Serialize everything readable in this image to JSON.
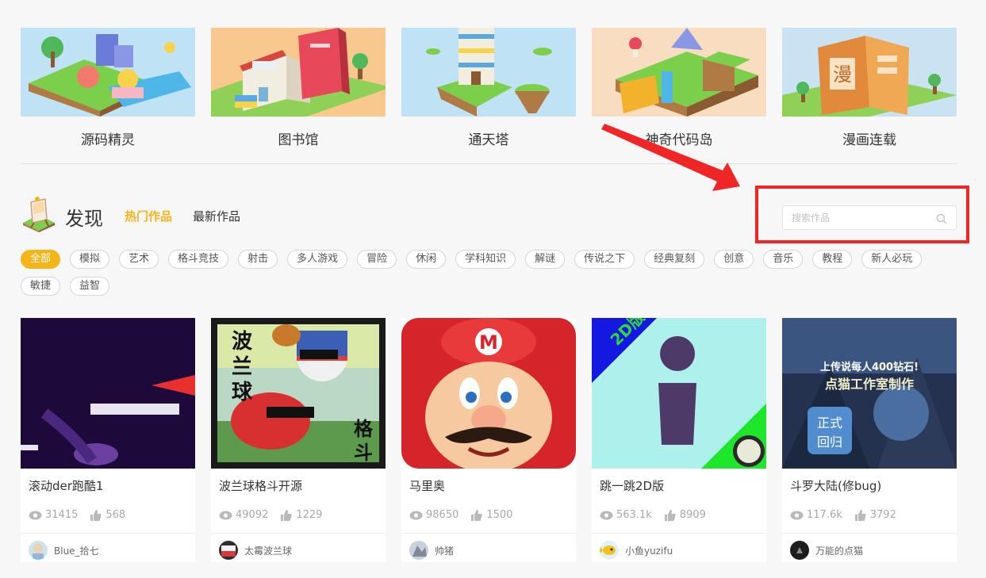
{
  "categories": [
    {
      "label": "源码精灵"
    },
    {
      "label": "图书馆"
    },
    {
      "label": "通天塔"
    },
    {
      "label": "神奇代码岛"
    },
    {
      "label": "漫画连载"
    }
  ],
  "discover": {
    "title": "发现",
    "tab_hot": "热门作品",
    "tab_new": "最新作品",
    "search_placeholder": "搜索作品",
    "accent": "#f4b51b"
  },
  "tags": [
    "全部",
    "模拟",
    "艺术",
    "格斗竞技",
    "射击",
    "多人游戏",
    "冒险",
    "休闲",
    "学科知识",
    "解谜",
    "传说之下",
    "经典复刻",
    "创意",
    "音乐",
    "教程",
    "新人必玩",
    "敏捷",
    "益智"
  ],
  "works": [
    {
      "title": "滚动der跑酷1",
      "views": "31415",
      "likes": "568",
      "author": "Blue_拾七"
    },
    {
      "title": "波兰球格斗开源",
      "views": "49092",
      "likes": "1229",
      "author": "太霉波兰球",
      "thumb_text": {
        "left": "波兰球",
        "right": "格斗"
      }
    },
    {
      "title": "马里奥",
      "views": "98650",
      "likes": "1500",
      "author": "帅猪"
    },
    {
      "title": "跳一跳2D版",
      "views": "563.1k",
      "likes": "8909",
      "author": "小鱼yuzifu",
      "thumb_text": {
        "corner": "2D版"
      }
    },
    {
      "title": "斗罗大陆(修bug)",
      "views": "117.6k",
      "likes": "3792",
      "author": "万能的点猫",
      "thumb_text": {
        "headline": "上传说每人400钻石!",
        "subline": "点猫工作室制作",
        "badge": "正式回归"
      }
    }
  ],
  "annotation_color": "#f02626"
}
